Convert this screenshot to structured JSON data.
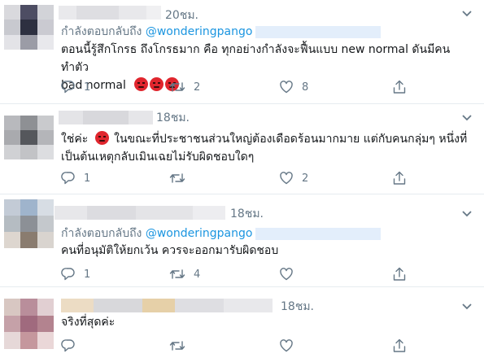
{
  "colors": {
    "accent": "#1b95e0",
    "muted": "#657786",
    "text": "#14171a",
    "divider": "#e6ecf0"
  },
  "tweets": [
    {
      "time": "20ชม.",
      "reply_prefix": "กำลังตอบกลับถึง",
      "reply_handle": "@wonderingpango",
      "text_line1": "ตอนนี้รู้สึกโกรธ ถึงโกรธมาก คือ ทุกอย่างกำลังจะฟื้นแบบ new normal ดันมีคนทำตัว",
      "text_line2": "bad normal",
      "emojis": [
        "pouting-face",
        "pouting-face",
        "pouting-face"
      ],
      "reply_count": "1",
      "retweet_count": "2",
      "like_count": "8"
    },
    {
      "time": "18ชม.",
      "text_pre": "ใช่ค่ะ",
      "text_post": " ในขณะที่ประชาชนส่วนใหญ่ต้องเดือดร้อนมากมาย แต่กับคนกลุ่มๆ หนึ่งที่",
      "text_line2": "เป็นต้นเหตุกลับเมินเฉยไม่รับผิดชอบใดๆ",
      "emojis": [
        "pouting-face"
      ],
      "reply_count": "1",
      "retweet_count": "",
      "like_count": "2"
    },
    {
      "time": "18ชม.",
      "reply_prefix": "กำลังตอบกลับถึง",
      "reply_handle": "@wonderingpango",
      "text": "คนที่อนุมัติให้ยกเว้น ควรจะออกมารับผิดชอบ",
      "reply_count": "1",
      "retweet_count": "4",
      "like_count": ""
    },
    {
      "time": "18ชม.",
      "text": "จริงที่สุดค่ะ"
    }
  ]
}
